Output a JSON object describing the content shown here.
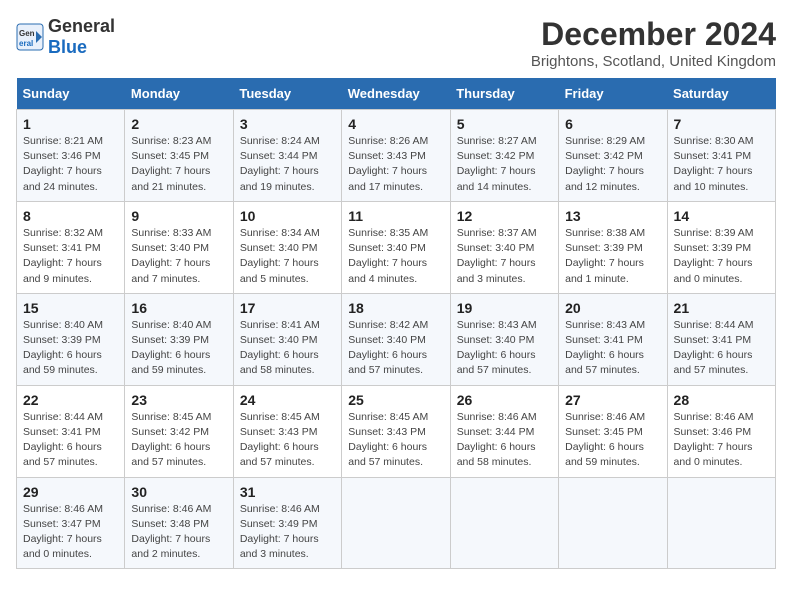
{
  "logo": {
    "text_general": "General",
    "text_blue": "Blue"
  },
  "title": "December 2024",
  "subtitle": "Brightons, Scotland, United Kingdom",
  "days_of_week": [
    "Sunday",
    "Monday",
    "Tuesday",
    "Wednesday",
    "Thursday",
    "Friday",
    "Saturday"
  ],
  "weeks": [
    [
      {
        "day": "1",
        "sunrise": "Sunrise: 8:21 AM",
        "sunset": "Sunset: 3:46 PM",
        "daylight": "Daylight: 7 hours and 24 minutes."
      },
      {
        "day": "2",
        "sunrise": "Sunrise: 8:23 AM",
        "sunset": "Sunset: 3:45 PM",
        "daylight": "Daylight: 7 hours and 21 minutes."
      },
      {
        "day": "3",
        "sunrise": "Sunrise: 8:24 AM",
        "sunset": "Sunset: 3:44 PM",
        "daylight": "Daylight: 7 hours and 19 minutes."
      },
      {
        "day": "4",
        "sunrise": "Sunrise: 8:26 AM",
        "sunset": "Sunset: 3:43 PM",
        "daylight": "Daylight: 7 hours and 17 minutes."
      },
      {
        "day": "5",
        "sunrise": "Sunrise: 8:27 AM",
        "sunset": "Sunset: 3:42 PM",
        "daylight": "Daylight: 7 hours and 14 minutes."
      },
      {
        "day": "6",
        "sunrise": "Sunrise: 8:29 AM",
        "sunset": "Sunset: 3:42 PM",
        "daylight": "Daylight: 7 hours and 12 minutes."
      },
      {
        "day": "7",
        "sunrise": "Sunrise: 8:30 AM",
        "sunset": "Sunset: 3:41 PM",
        "daylight": "Daylight: 7 hours and 10 minutes."
      }
    ],
    [
      {
        "day": "8",
        "sunrise": "Sunrise: 8:32 AM",
        "sunset": "Sunset: 3:41 PM",
        "daylight": "Daylight: 7 hours and 9 minutes."
      },
      {
        "day": "9",
        "sunrise": "Sunrise: 8:33 AM",
        "sunset": "Sunset: 3:40 PM",
        "daylight": "Daylight: 7 hours and 7 minutes."
      },
      {
        "day": "10",
        "sunrise": "Sunrise: 8:34 AM",
        "sunset": "Sunset: 3:40 PM",
        "daylight": "Daylight: 7 hours and 5 minutes."
      },
      {
        "day": "11",
        "sunrise": "Sunrise: 8:35 AM",
        "sunset": "Sunset: 3:40 PM",
        "daylight": "Daylight: 7 hours and 4 minutes."
      },
      {
        "day": "12",
        "sunrise": "Sunrise: 8:37 AM",
        "sunset": "Sunset: 3:40 PM",
        "daylight": "Daylight: 7 hours and 3 minutes."
      },
      {
        "day": "13",
        "sunrise": "Sunrise: 8:38 AM",
        "sunset": "Sunset: 3:39 PM",
        "daylight": "Daylight: 7 hours and 1 minute."
      },
      {
        "day": "14",
        "sunrise": "Sunrise: 8:39 AM",
        "sunset": "Sunset: 3:39 PM",
        "daylight": "Daylight: 7 hours and 0 minutes."
      }
    ],
    [
      {
        "day": "15",
        "sunrise": "Sunrise: 8:40 AM",
        "sunset": "Sunset: 3:39 PM",
        "daylight": "Daylight: 6 hours and 59 minutes."
      },
      {
        "day": "16",
        "sunrise": "Sunrise: 8:40 AM",
        "sunset": "Sunset: 3:39 PM",
        "daylight": "Daylight: 6 hours and 59 minutes."
      },
      {
        "day": "17",
        "sunrise": "Sunrise: 8:41 AM",
        "sunset": "Sunset: 3:40 PM",
        "daylight": "Daylight: 6 hours and 58 minutes."
      },
      {
        "day": "18",
        "sunrise": "Sunrise: 8:42 AM",
        "sunset": "Sunset: 3:40 PM",
        "daylight": "Daylight: 6 hours and 57 minutes."
      },
      {
        "day": "19",
        "sunrise": "Sunrise: 8:43 AM",
        "sunset": "Sunset: 3:40 PM",
        "daylight": "Daylight: 6 hours and 57 minutes."
      },
      {
        "day": "20",
        "sunrise": "Sunrise: 8:43 AM",
        "sunset": "Sunset: 3:41 PM",
        "daylight": "Daylight: 6 hours and 57 minutes."
      },
      {
        "day": "21",
        "sunrise": "Sunrise: 8:44 AM",
        "sunset": "Sunset: 3:41 PM",
        "daylight": "Daylight: 6 hours and 57 minutes."
      }
    ],
    [
      {
        "day": "22",
        "sunrise": "Sunrise: 8:44 AM",
        "sunset": "Sunset: 3:41 PM",
        "daylight": "Daylight: 6 hours and 57 minutes."
      },
      {
        "day": "23",
        "sunrise": "Sunrise: 8:45 AM",
        "sunset": "Sunset: 3:42 PM",
        "daylight": "Daylight: 6 hours and 57 minutes."
      },
      {
        "day": "24",
        "sunrise": "Sunrise: 8:45 AM",
        "sunset": "Sunset: 3:43 PM",
        "daylight": "Daylight: 6 hours and 57 minutes."
      },
      {
        "day": "25",
        "sunrise": "Sunrise: 8:45 AM",
        "sunset": "Sunset: 3:43 PM",
        "daylight": "Daylight: 6 hours and 57 minutes."
      },
      {
        "day": "26",
        "sunrise": "Sunrise: 8:46 AM",
        "sunset": "Sunset: 3:44 PM",
        "daylight": "Daylight: 6 hours and 58 minutes."
      },
      {
        "day": "27",
        "sunrise": "Sunrise: 8:46 AM",
        "sunset": "Sunset: 3:45 PM",
        "daylight": "Daylight: 6 hours and 59 minutes."
      },
      {
        "day": "28",
        "sunrise": "Sunrise: 8:46 AM",
        "sunset": "Sunset: 3:46 PM",
        "daylight": "Daylight: 7 hours and 0 minutes."
      }
    ],
    [
      {
        "day": "29",
        "sunrise": "Sunrise: 8:46 AM",
        "sunset": "Sunset: 3:47 PM",
        "daylight": "Daylight: 7 hours and 0 minutes."
      },
      {
        "day": "30",
        "sunrise": "Sunrise: 8:46 AM",
        "sunset": "Sunset: 3:48 PM",
        "daylight": "Daylight: 7 hours and 2 minutes."
      },
      {
        "day": "31",
        "sunrise": "Sunrise: 8:46 AM",
        "sunset": "Sunset: 3:49 PM",
        "daylight": "Daylight: 7 hours and 3 minutes."
      },
      null,
      null,
      null,
      null
    ]
  ]
}
